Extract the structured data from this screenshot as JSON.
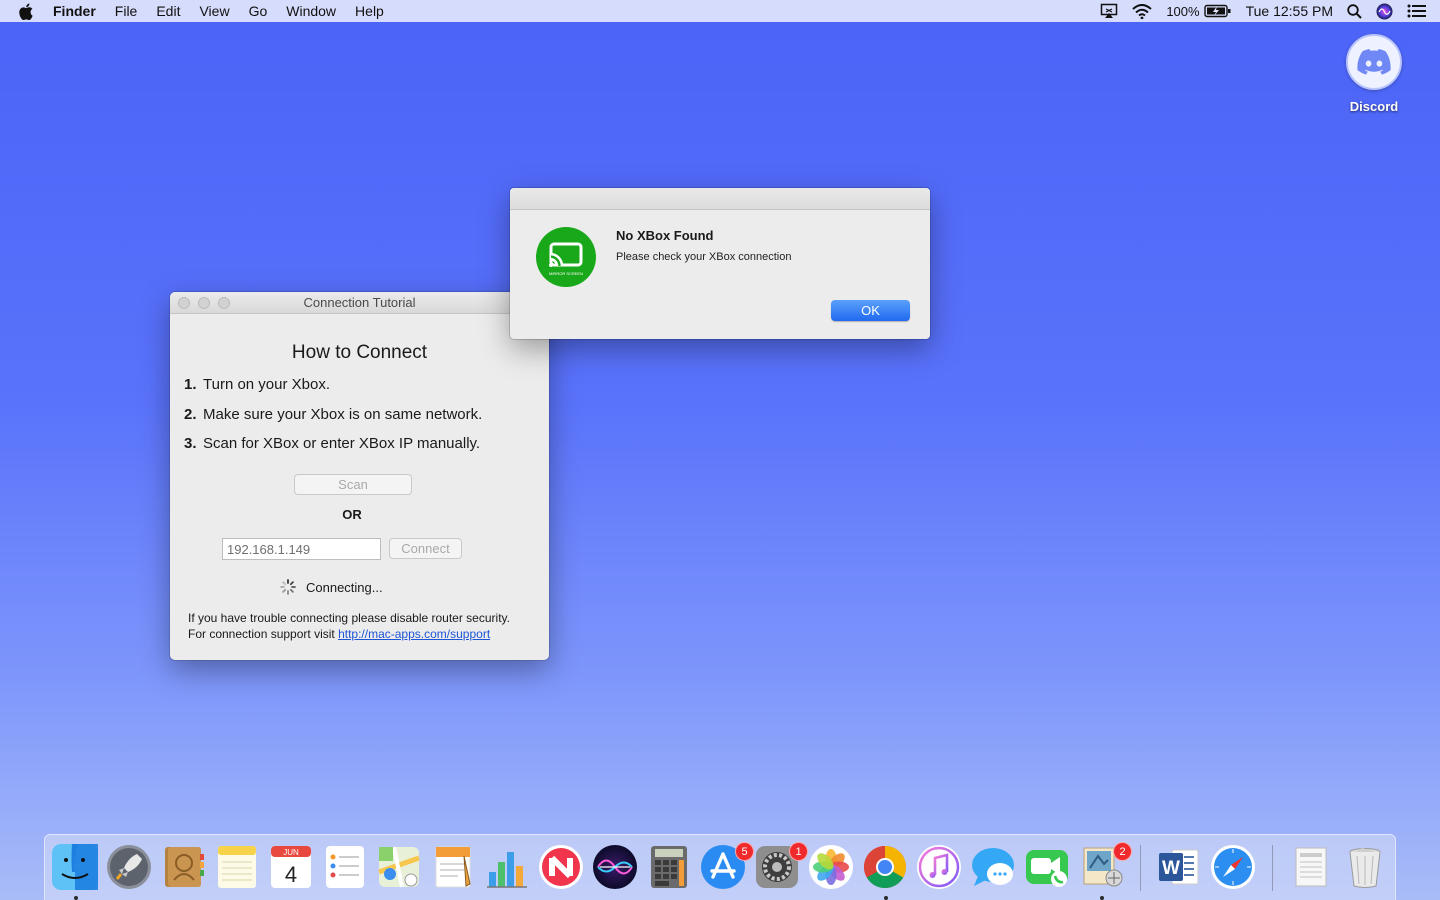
{
  "menubar": {
    "items": [
      "Finder",
      "File",
      "Edit",
      "View",
      "Go",
      "Window",
      "Help"
    ],
    "battery": "100%",
    "clock": "Tue 12:55 PM"
  },
  "desktop": {
    "icon_label": "Discord"
  },
  "tutorial_window": {
    "title": "Connection Tutorial",
    "heading": "How to Connect",
    "steps": [
      {
        "num": "1.",
        "text": "Turn on your Xbox."
      },
      {
        "num": "2.",
        "text": "Make sure your Xbox is on same network."
      },
      {
        "num": "3.",
        "text": "Scan for XBox or enter XBox IP manually."
      }
    ],
    "scan_label": "Scan",
    "or_label": "OR",
    "ip_value": "192.168.1.149",
    "connect_label": "Connect",
    "status": "Connecting...",
    "help_line1": "If you have trouble connecting please disable router security.",
    "help_line2_prefix": "For connection support visit ",
    "help_link": "http://mac-apps.com/support"
  },
  "alert": {
    "title": "No XBox Found",
    "message": "Please check your XBox connection",
    "ok_label": "OK",
    "icon_caption": "MIRROR SCREEN"
  },
  "dock": {
    "badges": {
      "app_store": "5",
      "system_preferences": "1",
      "mail": "2"
    },
    "calendar_month": "JUN",
    "calendar_day": "4",
    "word_letter": "W"
  },
  "colors": {
    "desktop_top": "#4b63f7",
    "accent_blue": "#2169f0",
    "app_green": "#19a819",
    "badge_red": "#f0292c"
  }
}
